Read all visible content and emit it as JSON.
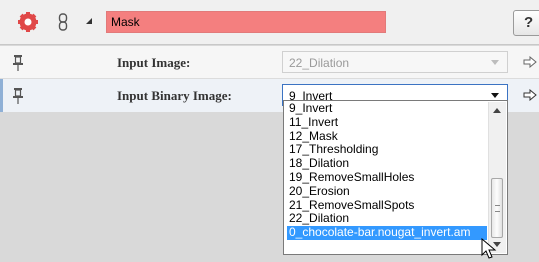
{
  "module": {
    "name": "Mask",
    "help_label": "?",
    "icons": {
      "main": "gear-icon",
      "link": "chain-link-icon",
      "expand": "collapse-triangle-icon"
    },
    "name_field_color": "#f47f7f"
  },
  "ports": [
    {
      "label": "Input Image:",
      "value": "22_Dilation",
      "enabled": false,
      "icon": "pin-icon"
    },
    {
      "label": "Input Binary Image:",
      "value": "9_Invert",
      "enabled": true,
      "icon": "pin-icon"
    }
  ],
  "dropdown": {
    "items": [
      "9_Invert",
      "11_Invert",
      "12_Mask",
      "17_Thresholding",
      "18_Dilation",
      "19_RemoveSmallHoles",
      "20_Erosion",
      "21_RemoveSmallSpots",
      "22_Dilation",
      "0_chocolate-bar.nougat_invert.am"
    ],
    "highlighted": "0_chocolate-bar.nougat_invert.am",
    "highlight_color": "#3399ff"
  }
}
